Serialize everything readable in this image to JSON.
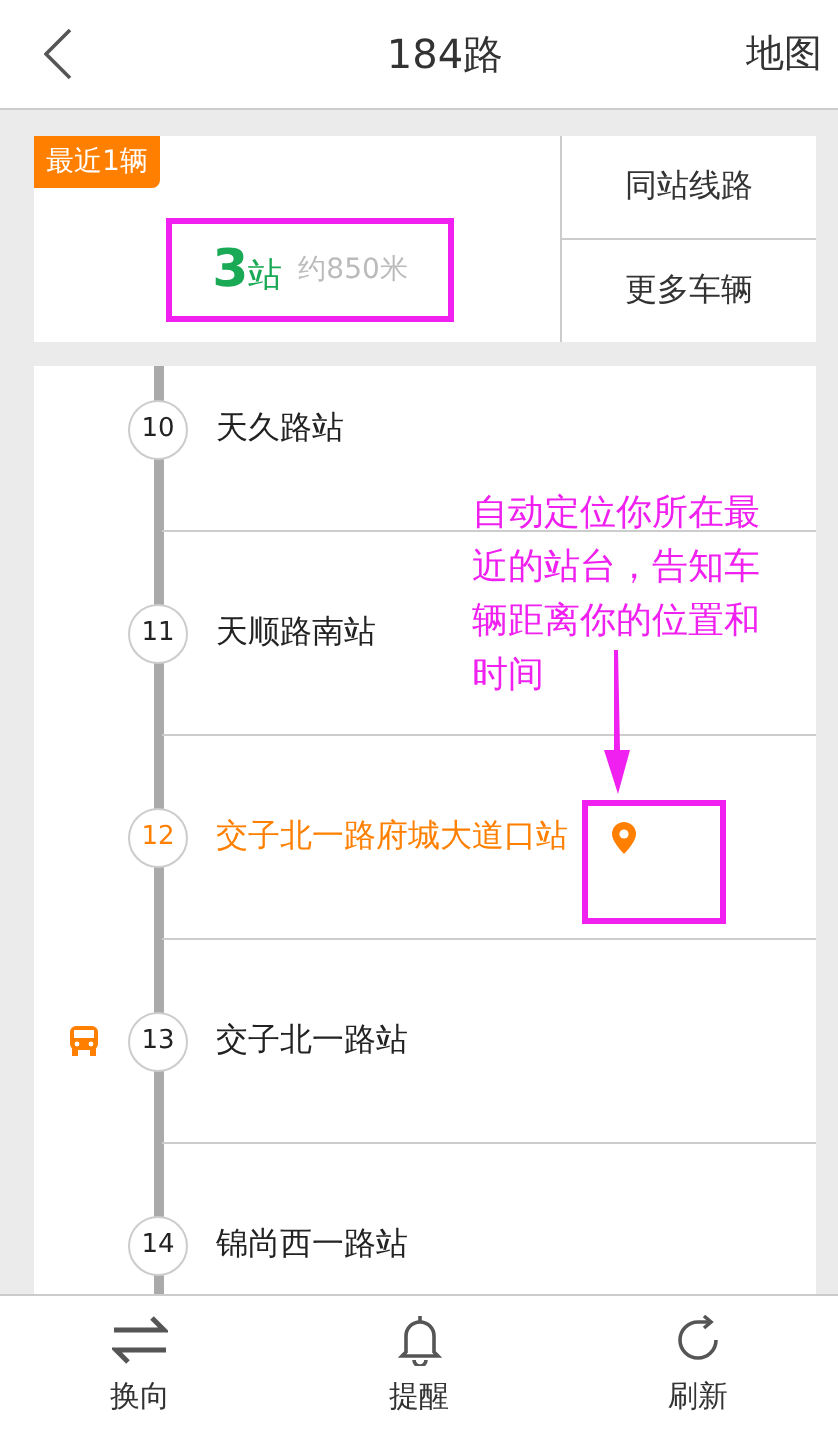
{
  "header": {
    "title": "184路",
    "action": "地图"
  },
  "nearest": {
    "badge": "最近1辆",
    "stops": "3",
    "stops_unit": "站",
    "distance": "约850米"
  },
  "side_buttons": [
    "同站线路",
    "更多车辆"
  ],
  "stations": [
    {
      "number": "10",
      "name": "天久路站",
      "current": false,
      "bus": false
    },
    {
      "number": "11",
      "name": "天顺路南站",
      "current": false,
      "bus": false
    },
    {
      "number": "12",
      "name": "交子北一路府城大道口站",
      "current": true,
      "bus": false
    },
    {
      "number": "13",
      "name": "交子北一路站",
      "current": false,
      "bus": true
    },
    {
      "number": "14",
      "name": "锦尚西一路站",
      "current": false,
      "bus": false
    }
  ],
  "annotation": {
    "text": "自动定位你所在最近的站台，告知车辆距离你的位置和时间"
  },
  "toolbar": [
    {
      "kind": "swap",
      "label": "换向"
    },
    {
      "kind": "bell",
      "label": "提醒"
    },
    {
      "kind": "refresh",
      "label": "刷新"
    }
  ]
}
